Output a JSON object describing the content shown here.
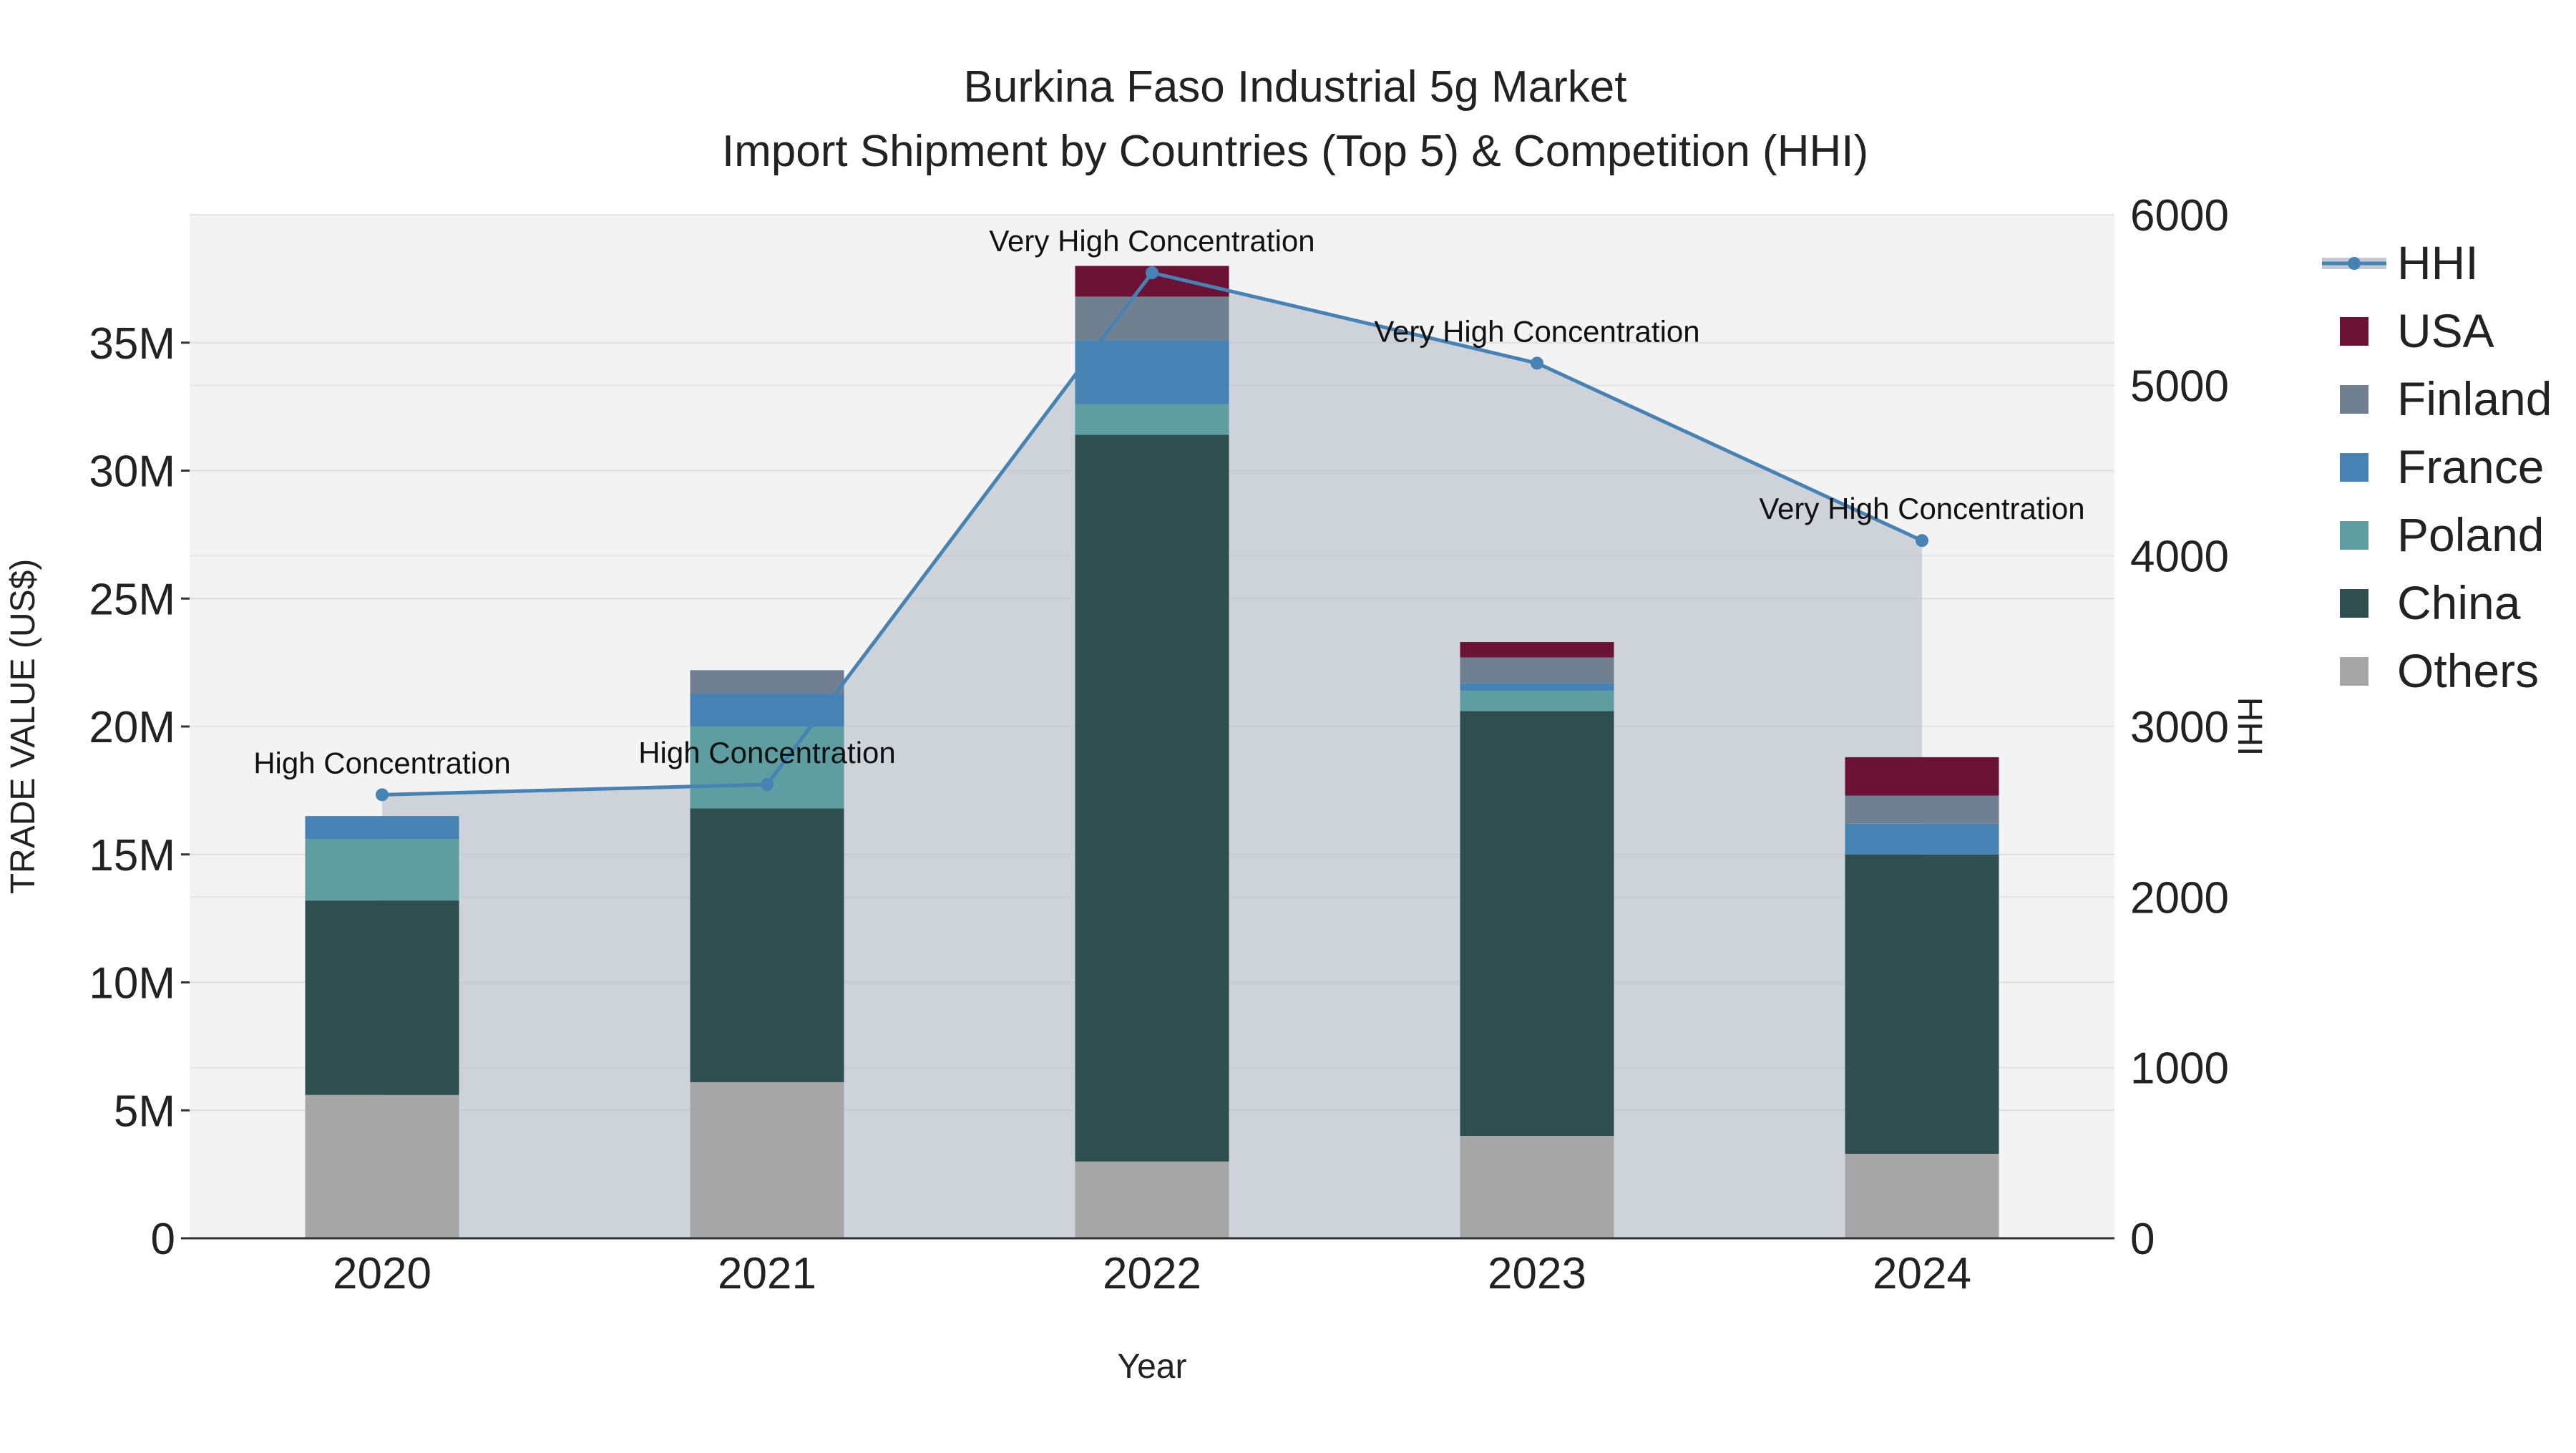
{
  "chart_data": {
    "type": "bar",
    "title": "Burkina Faso Industrial 5g Market",
    "subtitle": "Import Shipment by Countries (Top 5) & Competition (HHI)",
    "xlabel": "Year",
    "ylabel": "TRADE VALUE (US$)",
    "y2label": "HHI",
    "categories": [
      "2020",
      "2021",
      "2022",
      "2023",
      "2024"
    ],
    "ylim": [
      0,
      40000000
    ],
    "y2lim": [
      0,
      6000
    ],
    "y_ticks": [
      0,
      5000000,
      10000000,
      15000000,
      20000000,
      25000000,
      30000000,
      35000000
    ],
    "y_tick_labels": [
      "0",
      "5M",
      "10M",
      "15M",
      "20M",
      "25M",
      "30M",
      "35M"
    ],
    "y2_ticks": [
      0,
      1000,
      2000,
      3000,
      4000,
      5000,
      6000
    ],
    "y2_tick_labels": [
      "0",
      "1000",
      "2000",
      "3000",
      "4000",
      "5000",
      "6000"
    ],
    "grid": true,
    "legend_position": "right",
    "series": [
      {
        "name": "Others",
        "color": "#a6a6a6",
        "values": [
          5600000,
          6100000,
          3000000,
          4000000,
          3300000
        ]
      },
      {
        "name": "China",
        "color": "#2f4f4f",
        "values": [
          7600000,
          10700000,
          28400000,
          16600000,
          11700000
        ]
      },
      {
        "name": "Poland",
        "color": "#5f9ea0",
        "values": [
          2400000,
          3200000,
          1200000,
          800000,
          0
        ]
      },
      {
        "name": "France",
        "color": "#4682b4",
        "values": [
          900000,
          1300000,
          2500000,
          300000,
          1200000
        ]
      },
      {
        "name": "Finland",
        "color": "#708090",
        "values": [
          0,
          900000,
          1700000,
          1000000,
          1100000
        ]
      },
      {
        "name": "USA",
        "color": "#6b1235",
        "values": [
          0,
          0,
          1200000,
          600000,
          1500000
        ]
      }
    ],
    "line_series": {
      "name": "HHI",
      "color": "#4682b4",
      "values": [
        2600,
        2660,
        5660,
        5130,
        4090
      ],
      "labels": [
        "High Concentration",
        "High Concentration",
        "Very High Concentration",
        "Very High Concentration",
        "Very High Concentration"
      ]
    },
    "legend": [
      "HHI",
      "USA",
      "Finland",
      "France",
      "Poland",
      "China",
      "Others"
    ]
  }
}
